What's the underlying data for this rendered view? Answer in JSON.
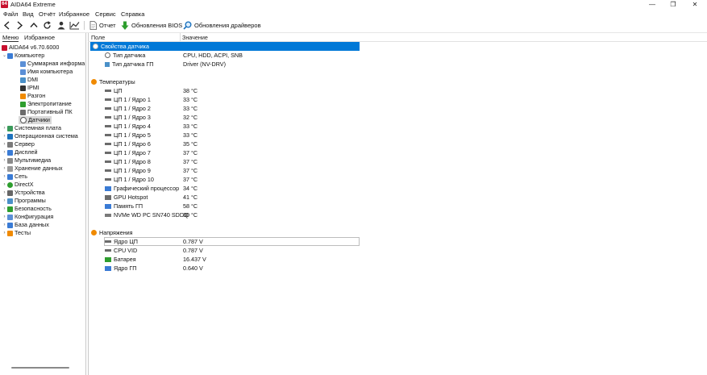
{
  "window": {
    "icon_text": "64",
    "title": "AIDA64 Extreme",
    "controls": [
      "—",
      "❐",
      "✕"
    ]
  },
  "menu": [
    "Файл",
    "Вид",
    "Отчёт",
    "Избранное",
    "Сервис",
    "Справка"
  ],
  "toolbar": {
    "report": "Отчет",
    "bios_update": "Обновления BIOS",
    "driver_update": "Обновления драйверов"
  },
  "left_tabs": {
    "menu": "Меню",
    "favorites": "Избранное"
  },
  "tree": {
    "root": "AIDA64 v6.70.6000",
    "computer": "Компьютер",
    "computer_children": [
      "Суммарная информа",
      "Имя компьютера",
      "DMI",
      "IPMI",
      "Разгон",
      "Электропитание",
      "Портативный ПК",
      "Датчики"
    ],
    "top_level": [
      "Системная плата",
      "Операционная система",
      "Сервер",
      "Дисплей",
      "Мультимедиа",
      "Хранение данных",
      "Сеть",
      "DirectX",
      "Устройства",
      "Программы",
      "Безопасность",
      "Конфигурация",
      "База данных",
      "Тесты"
    ]
  },
  "columns": {
    "field": "Поле",
    "value": "Значение"
  },
  "sections": {
    "sensor_props": {
      "title": "Свойства датчика",
      "rows": [
        {
          "field": "Тип датчика",
          "value": "CPU, HDD, ACPI, SNB"
        },
        {
          "field": "Тип датчика ГП",
          "value": "Driver  (NV-DRV)"
        }
      ]
    },
    "temperatures": {
      "title": "Температуры",
      "rows": [
        {
          "field": "ЦП",
          "value": "38 °C"
        },
        {
          "field": "ЦП 1 / Ядро 1",
          "value": "33 °C"
        },
        {
          "field": "ЦП 1 / Ядро 2",
          "value": "33 °C"
        },
        {
          "field": "ЦП 1 / Ядро 3",
          "value": "32 °C"
        },
        {
          "field": "ЦП 1 / Ядро 4",
          "value": "33 °C"
        },
        {
          "field": "ЦП 1 / Ядро 5",
          "value": "33 °C"
        },
        {
          "field": "ЦП 1 / Ядро 6",
          "value": "35 °C"
        },
        {
          "field": "ЦП 1 / Ядро 7",
          "value": "37 °C"
        },
        {
          "field": "ЦП 1 / Ядро 8",
          "value": "37 °C"
        },
        {
          "field": "ЦП 1 / Ядро 9",
          "value": "37 °C"
        },
        {
          "field": "ЦП 1 / Ядро 10",
          "value": "37 °C"
        },
        {
          "field": "Графический процессор",
          "value": "34 °C"
        },
        {
          "field": "GPU Hotspot",
          "value": "41 °C"
        },
        {
          "field": "Память ГП",
          "value": "58 °C"
        },
        {
          "field": "NVMe WD PC SN740 SDDQ",
          "value": "30 °C"
        }
      ]
    },
    "voltages": {
      "title": "Напряжения",
      "rows": [
        {
          "field": "Ядро ЦП",
          "value": "0.787 V"
        },
        {
          "field": "CPU VID",
          "value": "0.787 V"
        },
        {
          "field": "Батарея",
          "value": "16.437 V"
        },
        {
          "field": "Ядро ГП",
          "value": "0.640 V"
        }
      ]
    }
  },
  "colors": {
    "selection": "#0078d7",
    "brand": "#c8102e",
    "green_arrow": "#2e9e2e",
    "blue_icon": "#1e73be"
  }
}
